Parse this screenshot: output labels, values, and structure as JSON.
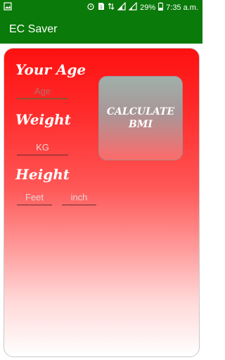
{
  "status": {
    "battery_pct": "29%",
    "time": "7:35 a.m."
  },
  "app": {
    "title": "EC Saver"
  },
  "form": {
    "age_label": "Your Age",
    "age_placeholder": "Age",
    "weight_label": "Weight",
    "weight_placeholder": "KG",
    "height_label": "Height",
    "feet_placeholder": "Feet",
    "inch_placeholder": "inch",
    "calculate_label": "CALCULATE BMI"
  },
  "colors": {
    "appbar": "#0a7a0a",
    "panel_top": "#ff1010",
    "panel_bottom": "#ffffff"
  }
}
